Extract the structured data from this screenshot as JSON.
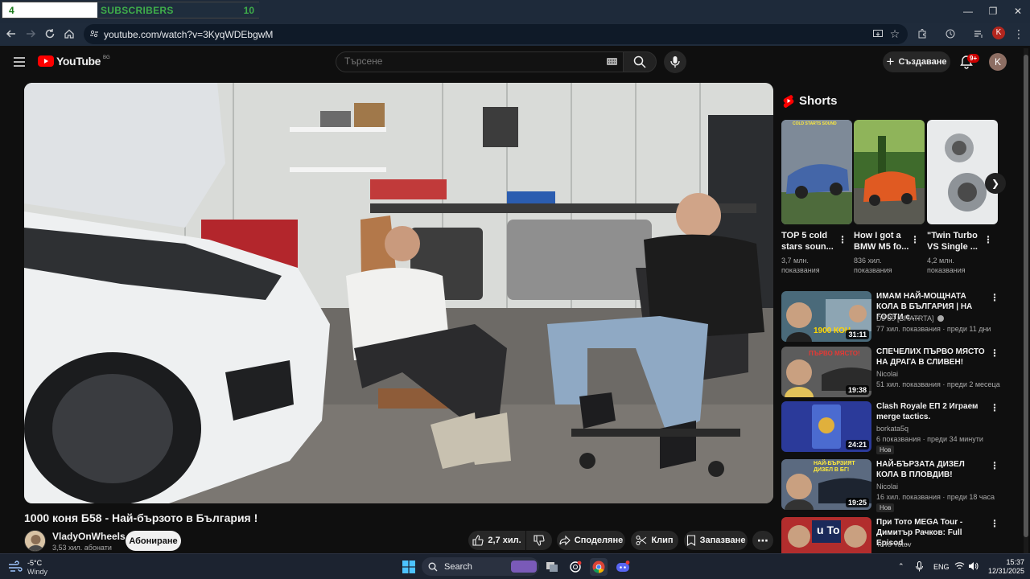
{
  "overlay": {
    "left_value": "4",
    "label": "SUBSCRIBERS",
    "right_value": "10"
  },
  "browser": {
    "url": "youtube.com/watch?v=3KyqWDEbgwM",
    "profile_initial": "K"
  },
  "youtube": {
    "logo_text": "YouTube",
    "logo_country": "BG",
    "search_placeholder": "Търсене",
    "create_label": "Създаване",
    "notifications_badge": "9+",
    "avatar_initial": "K"
  },
  "video": {
    "title": "1000 коня Б58 - Най-бързото в България !",
    "channel": "VladyOnWheels",
    "subscribers": "3,53 хил. абонати",
    "subscribe_label": "Абониране",
    "likes": "2,7 хил.",
    "share_label": "Споделяне",
    "clip_label": "Клип",
    "save_label": "Запазване"
  },
  "shorts": {
    "heading": "Shorts",
    "items": [
      {
        "title": "TOP 5 cold stars soun...",
        "views": "3,7 млн. показвания",
        "thumb_text": "COLD STARTS SOUND",
        "bg": "#6b7a8f"
      },
      {
        "title": "How I got a BMW M5 fo...",
        "views": "836 хил. показвания",
        "thumb_text": "",
        "bg": "#d2571f"
      },
      {
        "title": "\"Twin Turbo VS Single ...",
        "views": "4,2 млн. показвания",
        "thumb_text": "",
        "bg": "#e4e6e8"
      }
    ]
  },
  "recommendations": [
    {
      "title": "ИМАМ НАЙ-МОЩНАТА КОЛА В БЪЛГАРИЯ | НА ГОСТИ с ...",
      "channel": "DJ 89 [BRATRTA]",
      "meta": "77 хил. показвания · преди 11 дни",
      "duration": "31:11",
      "thumb_text": "1900 КОН",
      "new": "",
      "bg": "#4a6a7a"
    },
    {
      "title": "СПЕЧЕЛИХ ПЪРВО МЯСТО НА ДРАГА В СЛИВЕН!",
      "channel": "Nicolai",
      "meta": "51 хил. показвания · преди 2 месеца",
      "duration": "19:38",
      "thumb_text": "ПЪРВО МЯСТО!",
      "new": "",
      "bg": "#5c5c5c"
    },
    {
      "title": "Clash Royale ЕП 2 Играем merge tactics.",
      "channel": "borkata5q",
      "meta": "6 показвания · преди 34 минути",
      "duration": "24:21",
      "thumb_text": "",
      "new": "Нов",
      "bg": "#2b3a9a"
    },
    {
      "title": "НАЙ-БЪРЗАТА ДИЗЕЛ КОЛА В ПЛОВДИВ!",
      "channel": "Nicolai",
      "meta": "16 хил. показвания · преди 18 часа",
      "duration": "19:25",
      "thumb_text": "НАЙ-БЪРЗИЯТ ДИЗЕЛ В БГ!",
      "new": "Нов",
      "bg": "#5b6a80"
    },
    {
      "title": "При Тото MEGA Tour - Димитър Рачков: Full Episod...",
      "channel": "ToTo Yotov",
      "meta": "",
      "duration": "",
      "thumb_text": "u To",
      "new": "",
      "bg": "#b22d2d"
    }
  ],
  "taskbar": {
    "temperature": "-5°C",
    "weather": "Windy",
    "search_label": "Search",
    "language": "ENG",
    "time": "15:37",
    "date": "12/31/2025"
  }
}
